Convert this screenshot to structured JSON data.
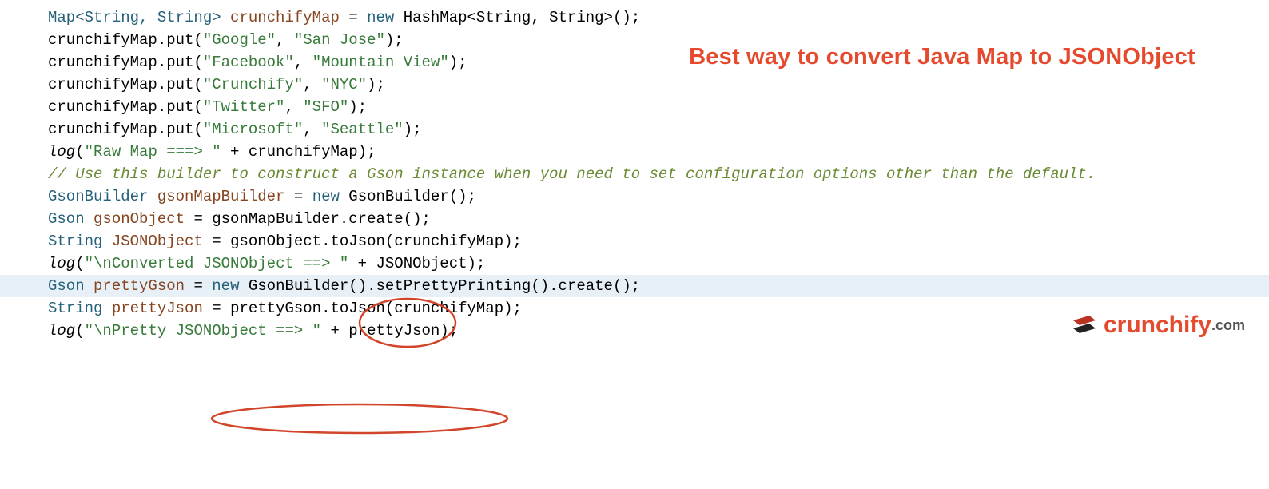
{
  "headline": "Best way to convert Java Map to JSONObject",
  "code": {
    "l1": {
      "a": "Map<String, String> ",
      "b": "crunchifyMap",
      "c": " = ",
      "d": "new ",
      "e": "HashMap<String, String>();"
    },
    "l2": {
      "a": "crunchifyMap.put(",
      "b": "\"Google\"",
      "c": ", ",
      "d": "\"San Jose\"",
      "e": ");"
    },
    "l3": {
      "a": "crunchifyMap.put(",
      "b": "\"Facebook\"",
      "c": ", ",
      "d": "\"Mountain View\"",
      "e": ");"
    },
    "l4": {
      "a": "crunchifyMap.put(",
      "b": "\"Crunchify\"",
      "c": ", ",
      "d": "\"NYC\"",
      "e": ");"
    },
    "l5": {
      "a": "crunchifyMap.put(",
      "b": "\"Twitter\"",
      "c": ", ",
      "d": "\"SFO\"",
      "e": ");"
    },
    "l6": {
      "a": "crunchifyMap.put(",
      "b": "\"Microsoft\"",
      "c": ", ",
      "d": "\"Seattle\"",
      "e": ");"
    },
    "l7": {
      "a": "log",
      "b": "(",
      "c": "\"Raw Map ===> \"",
      "d": " + crunchifyMap);"
    },
    "l8": "",
    "l9": "// Use this builder to construct a Gson instance when you need to set configuration options other than the default.",
    "l10": {
      "a": "GsonBuilder ",
      "b": "gsonMapBuilder",
      "c": " = ",
      "d": "new ",
      "e": "GsonBuilder();"
    },
    "l11": "",
    "l12": {
      "a": "Gson ",
      "b": "gsonObject",
      "c": " = gsonMapBuilder.create();"
    },
    "l13": "",
    "l14": {
      "a": "String ",
      "b": "JSONObject",
      "c": " = gsonObject.toJson(crunchifyMap);"
    },
    "l15": {
      "a": "log",
      "b": "(",
      "c": "\"\\nConverted JSONObject ==> \"",
      "d": " + JSONObject);"
    },
    "l16": "",
    "l17": {
      "a": "Gson ",
      "b": "prettyGson",
      "c": " = ",
      "d": "new ",
      "e": "GsonBuilder().setPrettyPrinting().create();"
    },
    "l18": {
      "a": "String ",
      "b": "prettyJson",
      "c": " = prettyGson.toJson(crunchifyMap);"
    },
    "l19": "",
    "l20": {
      "a": "log",
      "b": "(",
      "c": "\"\\nPretty JSONObject ==> \"",
      "d": " + prettyJson);"
    }
  },
  "logo": {
    "brand": "crunchify",
    "tld": ".com"
  },
  "annotations": {
    "circle1_target": "toJson",
    "circle2_target": "prettyGson.toJson(crunchifyMap);"
  }
}
